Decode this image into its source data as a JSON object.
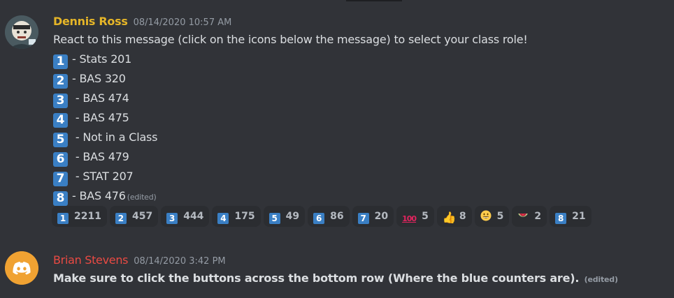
{
  "messages": [
    {
      "author": "Dennis Ross",
      "timestamp": "08/14/2020 10:57 AM",
      "intro": "React to this message (click on the icons below the message) to select your class role!",
      "roles": [
        {
          "key": "1",
          "text": "- Stats 201"
        },
        {
          "key": "2",
          "text": "- BAS 320"
        },
        {
          "key": "3",
          "text": " - BAS 474"
        },
        {
          "key": "4",
          "text": " - BAS 475"
        },
        {
          "key": "5",
          "text": " - Not in a Class"
        },
        {
          "key": "6",
          "text": " - BAS 479"
        },
        {
          "key": "7",
          "text": " - STAT 207"
        },
        {
          "key": "8",
          "text": "- BAS 476"
        }
      ],
      "edited_label": "(edited)",
      "reactions": [
        {
          "icon": "keycap-1-icon",
          "glyph": "1",
          "count": "2211"
        },
        {
          "icon": "keycap-2-icon",
          "glyph": "2",
          "count": "457"
        },
        {
          "icon": "keycap-3-icon",
          "glyph": "3",
          "count": "444"
        },
        {
          "icon": "keycap-4-icon",
          "glyph": "4",
          "count": "175"
        },
        {
          "icon": "keycap-5-icon",
          "glyph": "5",
          "count": "49"
        },
        {
          "icon": "keycap-6-icon",
          "glyph": "6",
          "count": "86"
        },
        {
          "icon": "keycap-7-icon",
          "glyph": "7",
          "count": "20"
        },
        {
          "icon": "hundred-points-icon",
          "glyph": "100",
          "count": "5"
        },
        {
          "icon": "thumbs-up-icon",
          "glyph": "👍",
          "count": "8"
        },
        {
          "icon": "grinning-face-icon",
          "glyph": "",
          "count": "5"
        },
        {
          "icon": "watermelon-icon",
          "glyph": "",
          "count": "2"
        },
        {
          "icon": "keycap-8-icon",
          "glyph": "8",
          "count": "21"
        }
      ]
    },
    {
      "author": "Brian Stevens",
      "timestamp": "08/14/2020 3:42 PM",
      "text": "Make sure to click the buttons across the bottom row (Where the blue counters are).",
      "edited_label": "(edited)"
    }
  ],
  "colors": {
    "background": "#313338",
    "author1": "#e5b528",
    "author2": "#ea4a43",
    "keycap": "#3a7fc4",
    "reaction_bg": "#2b2d31"
  }
}
